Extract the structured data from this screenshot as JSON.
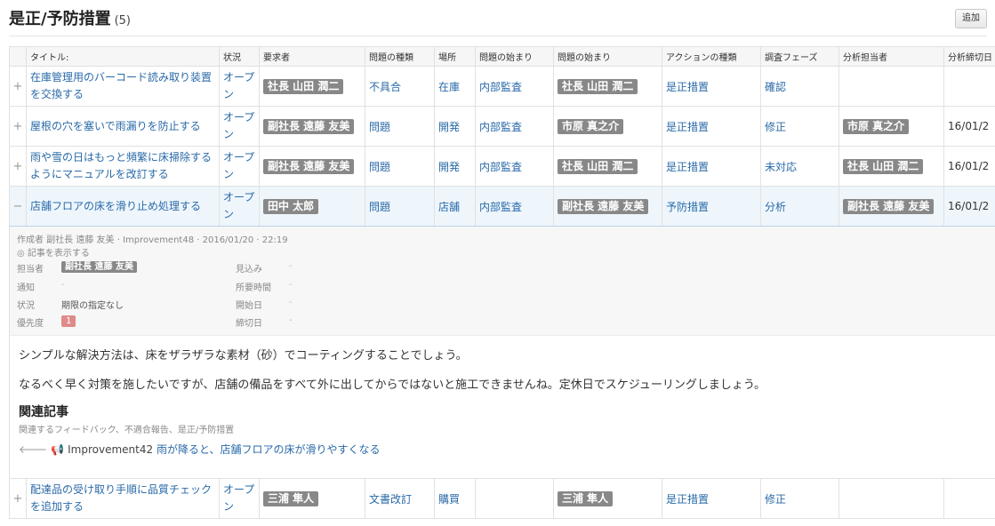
{
  "header": {
    "title": "是正/予防措置",
    "count": "(5)",
    "add_label": "追加"
  },
  "columns": [
    "",
    "タイトル:",
    "状況",
    "要求者",
    "問題の種類",
    "場所",
    "問題の始まり",
    "問題の始まり",
    "アクションの種類",
    "調査フェーズ",
    "分析担当者",
    "分析締切日"
  ],
  "rows": [
    {
      "toggle": "+",
      "title": "在庫管理用のバーコード読み取り装置を交換する",
      "status": "オープン",
      "requester": "社長 山田 潤二",
      "issue_type": "不具合",
      "location": "在庫",
      "origin1": "内部監査",
      "origin2": "社長 山田 潤二",
      "action_type": "是正措置",
      "phase": "確認",
      "analyst": "",
      "deadline": ""
    },
    {
      "toggle": "+",
      "title": "屋根の穴を塞いで雨漏りを防止する",
      "status": "オープン",
      "requester": "副社長 遠藤 友美",
      "issue_type": "問題",
      "location": "開発",
      "origin1": "内部監査",
      "origin2": "市原 真之介",
      "action_type": "是正措置",
      "phase": "修正",
      "analyst": "市原 真之介",
      "deadline": "16/01/2"
    },
    {
      "toggle": "+",
      "title": "雨や雪の日はもっと頻繁に床掃除するようにマニュアルを改訂する",
      "status": "オープン",
      "requester": "副社長 遠藤 友美",
      "issue_type": "問題",
      "location": "開発",
      "origin1": "内部監査",
      "origin2": "社長 山田 潤二",
      "action_type": "是正措置",
      "phase": "未対応",
      "analyst": "社長 山田 潤二",
      "deadline": "16/01/2"
    },
    {
      "toggle": "−",
      "title": "店舗フロアの床を滑り止め処理する",
      "status": "オープン",
      "requester": "田中 太郎",
      "issue_type": "問題",
      "location": "店舗",
      "origin1": "内部監査",
      "origin2": "副社長 遠藤 友美",
      "action_type": "予防措置",
      "phase": "分析",
      "analyst": "副社長 遠藤 友美",
      "deadline": "16/01/2"
    },
    {
      "toggle": "+",
      "title": "配達品の受け取り手順に品質チェックを追加する",
      "status": "オープン",
      "requester": "三浦 隼人",
      "issue_type": "文書改訂",
      "location": "購買",
      "origin1": "",
      "origin2": "三浦 隼人",
      "action_type": "是正措置",
      "phase": "修正",
      "analyst": "",
      "deadline": ""
    }
  ],
  "detail": {
    "author_line": "作成者 副社長 遠藤 友美 · Improvement48 · 2016/01/20 · 22:19",
    "show_article": "◎ 記事を表示する",
    "fields": {
      "assignee_label": "担当者",
      "assignee": "副社長 遠藤 友美",
      "notify_label": "通知",
      "notify": "-",
      "state_label": "状況",
      "state": "期限の指定なし",
      "priority_label": "優先度",
      "priority": "1",
      "estimate_label": "見込み",
      "estimate": "-",
      "time_label": "所要時間",
      "time": "-",
      "start_label": "開始日",
      "start": "-",
      "due_label": "締切日",
      "due": "-"
    },
    "body1": "シンプルな解決方法は、床をザラザラな素材（砂）でコーティングすることでしょう。",
    "body2": "なるべく早く対策を施したいですが、店舗の備品をすべて外に出してからではないと施工できませんね。定休日でスケジューリングしましょう。",
    "related_title": "関連記事",
    "related_sub": "関連するフィードバック、不適合報告、是正/予防措置",
    "related_id": "Improvement42",
    "related_link": "雨が降ると、店舗フロアの床が滑りやすくなる"
  },
  "icons": {
    "expand": "plus-icon",
    "collapse": "minus-icon",
    "back": "arrow-left-icon",
    "announce": "megaphone-icon"
  }
}
